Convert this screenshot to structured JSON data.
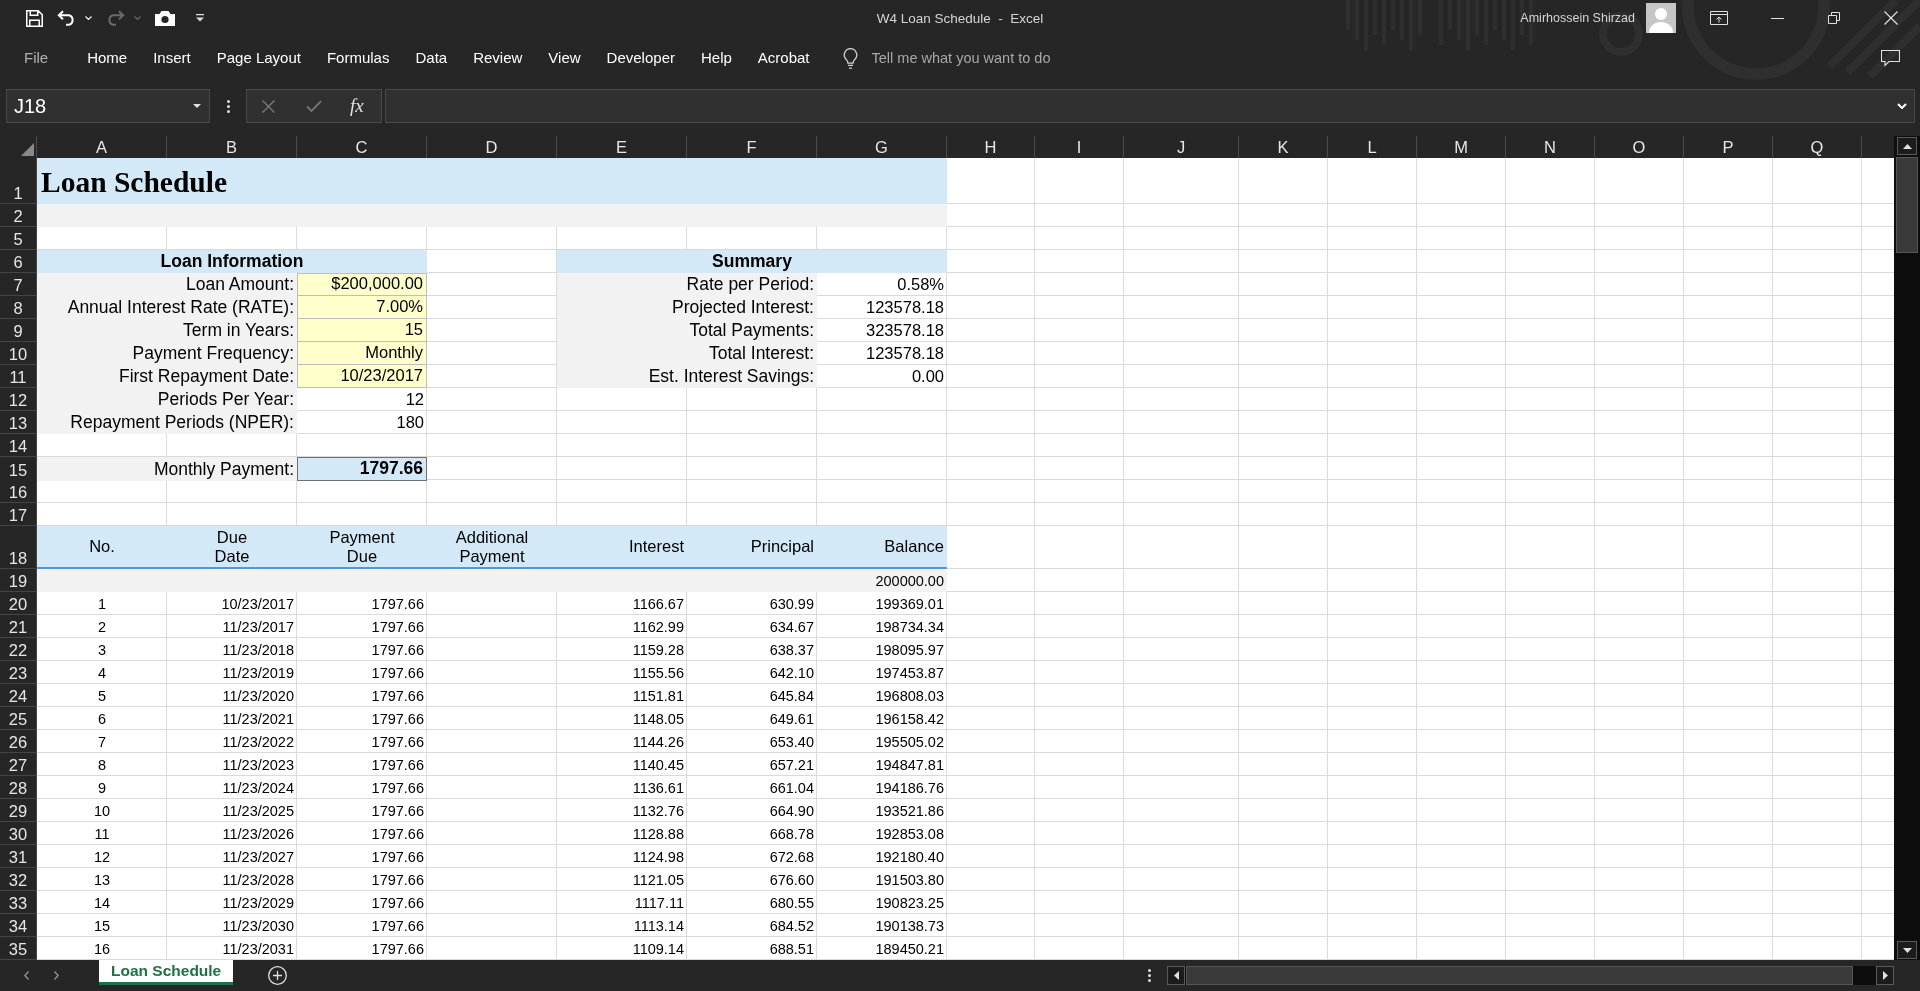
{
  "title_bar": {
    "quick_access": [
      {
        "kind": "save",
        "disabled": false
      },
      {
        "kind": "undo",
        "disabled": false
      },
      {
        "kind": "redo",
        "disabled": true
      },
      {
        "kind": "camera",
        "disabled": false
      }
    ],
    "title": "W4 Loan Schedule  -  Excel",
    "user_name": "Amirhossein Shirzad"
  },
  "ribbon_tabs": [
    {
      "label": "File",
      "kind": "file",
      "selected": false
    },
    {
      "label": "Home",
      "kind": "tab",
      "selected": false
    },
    {
      "label": "Insert",
      "kind": "tab",
      "selected": false
    },
    {
      "label": "Page Layout",
      "kind": "tab",
      "selected": false
    },
    {
      "label": "Formulas",
      "kind": "tab",
      "selected": false
    },
    {
      "label": "Data",
      "kind": "tab",
      "selected": false
    },
    {
      "label": "Review",
      "kind": "tab",
      "selected": false
    },
    {
      "label": "View",
      "kind": "tab",
      "selected": false
    },
    {
      "label": "Developer",
      "kind": "tab",
      "selected": false
    },
    {
      "label": "Help",
      "kind": "tab",
      "selected": false
    },
    {
      "label": "Acrobat",
      "kind": "tab",
      "selected": false
    }
  ],
  "tell_me": {
    "placeholder": "Tell me what you want to do"
  },
  "formula_bar": {
    "name_box": "J18",
    "function_button": "fx"
  },
  "sheet": {
    "columns": [
      "A",
      "B",
      "C",
      "D",
      "E",
      "F",
      "G",
      "H",
      "I",
      "J",
      "K",
      "L",
      "M",
      "N",
      "O",
      "P",
      "Q"
    ],
    "row_numbers": [
      "1",
      "2",
      "5",
      "6",
      "7",
      "8",
      "9",
      "10",
      "11",
      "12",
      "13",
      "14",
      "15",
      "16",
      "17",
      "18",
      "19",
      "20",
      "21",
      "22",
      "23",
      "24",
      "25",
      "26",
      "27",
      "28",
      "29",
      "30",
      "31",
      "32",
      "33",
      "34",
      "35"
    ],
    "title": "Loan Schedule",
    "loan_information": {
      "heading": "Loan Information",
      "fields": [
        {
          "label": "Loan Amount:",
          "value": "$200,000.00",
          "kind": "input"
        },
        {
          "label": "Annual Interest Rate (RATE):",
          "value": "7.00%",
          "kind": "input"
        },
        {
          "label": "Term in Years:",
          "value": "15",
          "kind": "input"
        },
        {
          "label": "Payment Frequency:",
          "value": "Monthly",
          "kind": "input"
        },
        {
          "label": "First Repayment Date:",
          "value": "10/23/2017",
          "kind": "input"
        },
        {
          "label": "Periods Per Year:",
          "value": "12",
          "kind": "calculated"
        },
        {
          "label": "Repayment Periods (NPER):",
          "value": "180",
          "kind": "calculated"
        }
      ]
    },
    "summary": {
      "heading": "Summary",
      "fields": [
        {
          "label": "Rate per Period:",
          "value": "0.58%"
        },
        {
          "label": "Projected Interest:",
          "value": "123578.18"
        },
        {
          "label": "Total Payments:",
          "value": "323578.18"
        },
        {
          "label": "Total Interest:",
          "value": "123578.18"
        },
        {
          "label": "Est. Interest Savings:",
          "value": "0.00"
        }
      ]
    },
    "monthly_payment": {
      "label": "Monthly Payment:",
      "value": "1797.66"
    },
    "schedule": {
      "columns": [
        "No.",
        "Due Date",
        "Payment Due",
        "Additional Payment",
        "Interest",
        "Principal",
        "Balance"
      ],
      "opening_balance": "200000.00",
      "rows": [
        {
          "no": "1",
          "due_date": "10/23/2017",
          "payment_due": "1797.66",
          "interest": "1166.67",
          "principal": "630.99",
          "balance": "199369.01"
        },
        {
          "no": "2",
          "due_date": "11/23/2017",
          "payment_due": "1797.66",
          "interest": "1162.99",
          "principal": "634.67",
          "balance": "198734.34"
        },
        {
          "no": "3",
          "due_date": "11/23/2018",
          "payment_due": "1797.66",
          "interest": "1159.28",
          "principal": "638.37",
          "balance": "198095.97"
        },
        {
          "no": "4",
          "due_date": "11/23/2019",
          "payment_due": "1797.66",
          "interest": "1155.56",
          "principal": "642.10",
          "balance": "197453.87"
        },
        {
          "no": "5",
          "due_date": "11/23/2020",
          "payment_due": "1797.66",
          "interest": "1151.81",
          "principal": "645.84",
          "balance": "196808.03"
        },
        {
          "no": "6",
          "due_date": "11/23/2021",
          "payment_due": "1797.66",
          "interest": "1148.05",
          "principal": "649.61",
          "balance": "196158.42"
        },
        {
          "no": "7",
          "due_date": "11/23/2022",
          "payment_due": "1797.66",
          "interest": "1144.26",
          "principal": "653.40",
          "balance": "195505.02"
        },
        {
          "no": "8",
          "due_date": "11/23/2023",
          "payment_due": "1797.66",
          "interest": "1140.45",
          "principal": "657.21",
          "balance": "194847.81"
        },
        {
          "no": "9",
          "due_date": "11/23/2024",
          "payment_due": "1797.66",
          "interest": "1136.61",
          "principal": "661.04",
          "balance": "194186.76"
        },
        {
          "no": "10",
          "due_date": "11/23/2025",
          "payment_due": "1797.66",
          "interest": "1132.76",
          "principal": "664.90",
          "balance": "193521.86"
        },
        {
          "no": "11",
          "due_date": "11/23/2026",
          "payment_due": "1797.66",
          "interest": "1128.88",
          "principal": "668.78",
          "balance": "192853.08"
        },
        {
          "no": "12",
          "due_date": "11/23/2027",
          "payment_due": "1797.66",
          "interest": "1124.98",
          "principal": "672.68",
          "balance": "192180.40"
        },
        {
          "no": "13",
          "due_date": "11/23/2028",
          "payment_due": "1797.66",
          "interest": "1121.05",
          "principal": "676.60",
          "balance": "191503.80"
        },
        {
          "no": "14",
          "due_date": "11/23/2029",
          "payment_due": "1797.66",
          "interest": "1117.11",
          "principal": "680.55",
          "balance": "190823.25"
        },
        {
          "no": "15",
          "due_date": "11/23/2030",
          "payment_due": "1797.66",
          "interest": "1113.14",
          "principal": "684.52",
          "balance": "190138.73"
        },
        {
          "no": "16",
          "due_date": "11/23/2031",
          "payment_due": "1797.66",
          "interest": "1109.14",
          "principal": "688.51",
          "balance": "189450.21"
        }
      ]
    }
  },
  "sheet_tabs": [
    {
      "label": "Loan Schedule",
      "selected": true
    }
  ]
}
